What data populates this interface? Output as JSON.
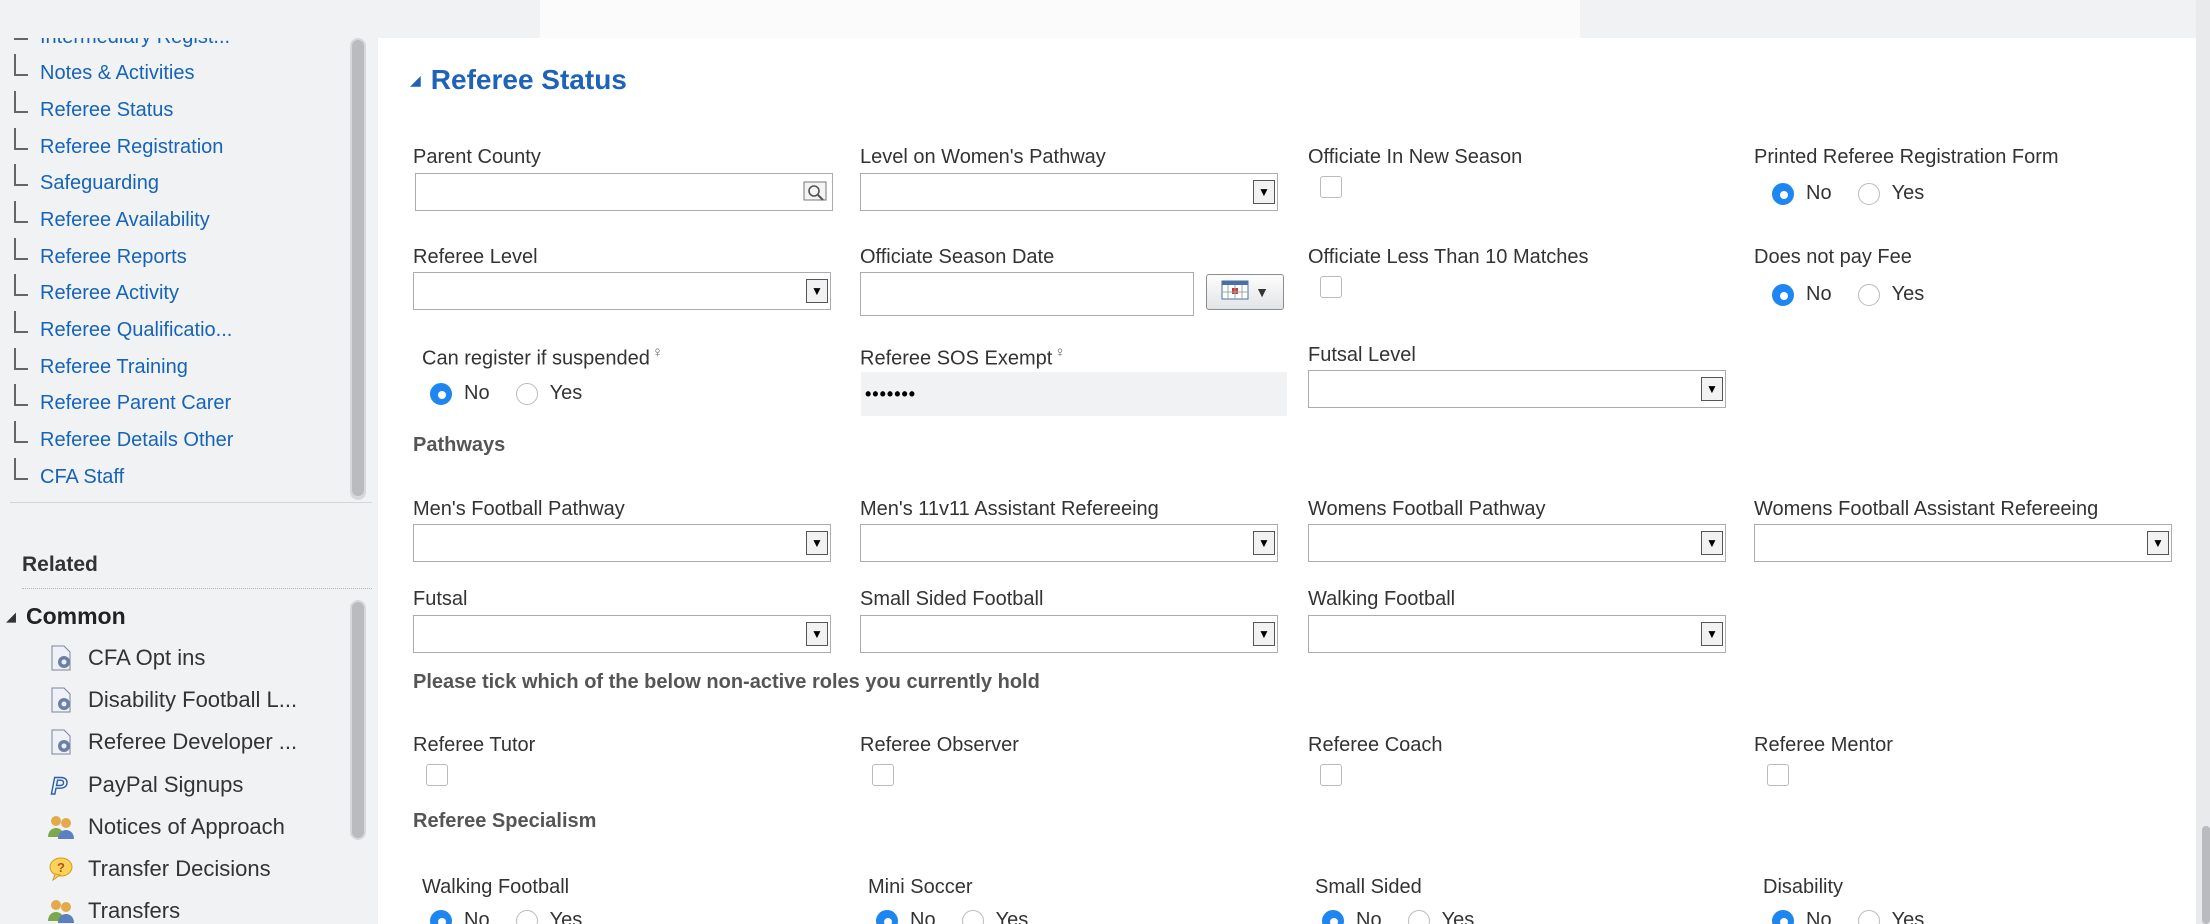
{
  "sidebar": {
    "nav_items": [
      {
        "label": "Intermediary Regist..."
      },
      {
        "label": "Notes & Activities"
      },
      {
        "label": "Referee Status"
      },
      {
        "label": "Referee Registration"
      },
      {
        "label": "Safeguarding"
      },
      {
        "label": "Referee Availability"
      },
      {
        "label": "Referee Reports"
      },
      {
        "label": "Referee Activity"
      },
      {
        "label": "Referee Qualificatio..."
      },
      {
        "label": "Referee Training"
      },
      {
        "label": "Referee Parent Carer"
      },
      {
        "label": "Referee Details Other"
      },
      {
        "label": "CFA Staff"
      }
    ],
    "related_heading": "Related",
    "common_heading": "Common",
    "related_items": [
      {
        "label": "CFA Opt ins",
        "icon": "report-icon"
      },
      {
        "label": "Disability Football L...",
        "icon": "report-icon"
      },
      {
        "label": "Referee Developer ...",
        "icon": "report-icon"
      },
      {
        "label": "PayPal Signups",
        "icon": "paypal-icon"
      },
      {
        "label": "Notices of Approach",
        "icon": "people-icon"
      },
      {
        "label": "Transfer Decisions",
        "icon": "question-icon"
      },
      {
        "label": "Transfers",
        "icon": "people-icon"
      }
    ]
  },
  "section": {
    "title": "Referee Status"
  },
  "fields": {
    "parent_county": {
      "label": "Parent County",
      "value": ""
    },
    "level_womens_pathway": {
      "label": "Level on Women's Pathway",
      "value": ""
    },
    "officiate_new_season": {
      "label": "Officiate In New Season",
      "checked": false
    },
    "printed_form": {
      "label": "Printed Referee Registration Form",
      "options": [
        "No",
        "Yes"
      ],
      "selected": "No"
    },
    "referee_level": {
      "label": "Referee Level",
      "value": ""
    },
    "officiate_season_date": {
      "label": "Officiate Season Date",
      "value": ""
    },
    "officiate_less_10": {
      "label": "Officiate Less Than 10 Matches",
      "checked": false
    },
    "does_not_pay_fee": {
      "label": "Does not pay Fee",
      "options": [
        "No",
        "Yes"
      ],
      "selected": "No"
    },
    "can_register_suspended": {
      "label": "Can register if suspended",
      "options": [
        "No",
        "Yes"
      ],
      "selected": "No"
    },
    "sos_exempt": {
      "label": "Referee SOS Exempt",
      "value": "•••••••"
    },
    "futsal_level": {
      "label": "Futsal Level",
      "value": ""
    }
  },
  "pathways": {
    "heading": "Pathways",
    "mens_pathway": {
      "label": "Men's Football Pathway",
      "value": ""
    },
    "mens_assistant": {
      "label": "Men's 11v11 Assistant Refereeing",
      "value": ""
    },
    "womens_pathway": {
      "label": "Womens Football Pathway",
      "value": ""
    },
    "womens_assistant": {
      "label": "Womens Football Assistant Refereeing",
      "value": ""
    },
    "futsal": {
      "label": "Futsal",
      "value": ""
    },
    "small_sided": {
      "label": "Small Sided Football",
      "value": ""
    },
    "walking": {
      "label": "Walking Football",
      "value": ""
    }
  },
  "roles": {
    "heading": "Please tick which of the below non-active roles you currently hold",
    "items": [
      {
        "label": "Referee Tutor",
        "checked": false
      },
      {
        "label": "Referee Observer",
        "checked": false
      },
      {
        "label": "Referee Coach",
        "checked": false
      },
      {
        "label": "Referee Mentor",
        "checked": false
      }
    ]
  },
  "specialism": {
    "heading": "Referee Specialism",
    "items": [
      {
        "label": "Walking Football",
        "options": [
          "No",
          "Yes"
        ],
        "selected": "No"
      },
      {
        "label": "Mini Soccer",
        "options": [
          "No",
          "Yes"
        ],
        "selected": "No"
      },
      {
        "label": "Small Sided",
        "options": [
          "No",
          "Yes"
        ],
        "selected": "No"
      },
      {
        "label": "Disability",
        "options": [
          "No",
          "Yes"
        ],
        "selected": "No"
      }
    ]
  },
  "colors": {
    "link": "#1664b8",
    "title": "#1f63b8",
    "radio_selected": "#1e86f0",
    "sidebar_bg": "#f1f2f4"
  }
}
